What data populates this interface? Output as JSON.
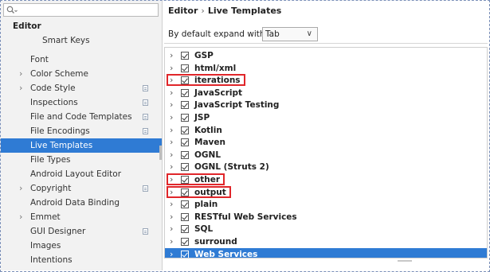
{
  "search": {
    "placeholder": ""
  },
  "sidebar": {
    "group": "Editor",
    "items": [
      {
        "label": "Smart Keys",
        "chevron": false,
        "project": false,
        "sub": true
      },
      {
        "label": "Font",
        "chevron": false,
        "project": false
      },
      {
        "label": "Color Scheme",
        "chevron": true,
        "project": false
      },
      {
        "label": "Code Style",
        "chevron": true,
        "project": true
      },
      {
        "label": "Inspections",
        "chevron": false,
        "project": true
      },
      {
        "label": "File and Code Templates",
        "chevron": false,
        "project": true
      },
      {
        "label": "File Encodings",
        "chevron": false,
        "project": true
      },
      {
        "label": "Live Templates",
        "chevron": false,
        "project": false,
        "selected": true
      },
      {
        "label": "File Types",
        "chevron": false,
        "project": false
      },
      {
        "label": "Android Layout Editor",
        "chevron": false,
        "project": false
      },
      {
        "label": "Copyright",
        "chevron": true,
        "project": true
      },
      {
        "label": "Android Data Binding",
        "chevron": false,
        "project": false
      },
      {
        "label": "Emmet",
        "chevron": true,
        "project": false
      },
      {
        "label": "GUI Designer",
        "chevron": false,
        "project": true
      },
      {
        "label": "Images",
        "chevron": false,
        "project": false
      },
      {
        "label": "Intentions",
        "chevron": false,
        "project": false
      }
    ]
  },
  "breadcrumb": {
    "parent": "Editor",
    "separator": "›",
    "current": "Live Templates"
  },
  "expand": {
    "label": "By default expand with",
    "value": "Tab",
    "arrow": "∨"
  },
  "tree": [
    {
      "name": "GSP",
      "checked": true
    },
    {
      "name": "html/xml",
      "checked": true
    },
    {
      "name": "iterations",
      "checked": true,
      "highlighted": true
    },
    {
      "name": "JavaScript",
      "checked": true
    },
    {
      "name": "JavaScript Testing",
      "checked": true
    },
    {
      "name": "JSP",
      "checked": true
    },
    {
      "name": "Kotlin",
      "checked": true
    },
    {
      "name": "Maven",
      "checked": true
    },
    {
      "name": "OGNL",
      "checked": true
    },
    {
      "name": "OGNL (Struts 2)",
      "checked": true
    },
    {
      "name": "other",
      "checked": true,
      "highlighted": true
    },
    {
      "name": "output",
      "checked": true,
      "highlighted": true
    },
    {
      "name": "plain",
      "checked": true
    },
    {
      "name": "RESTful Web Services",
      "checked": true
    },
    {
      "name": "SQL",
      "checked": true
    },
    {
      "name": "surround",
      "checked": true
    },
    {
      "name": "Web Services",
      "checked": true,
      "selected": true
    }
  ],
  "colors": {
    "selection": "#2f7bd4",
    "highlight_box": "#e0262a",
    "sidebar_bg": "#f2f2f2"
  }
}
